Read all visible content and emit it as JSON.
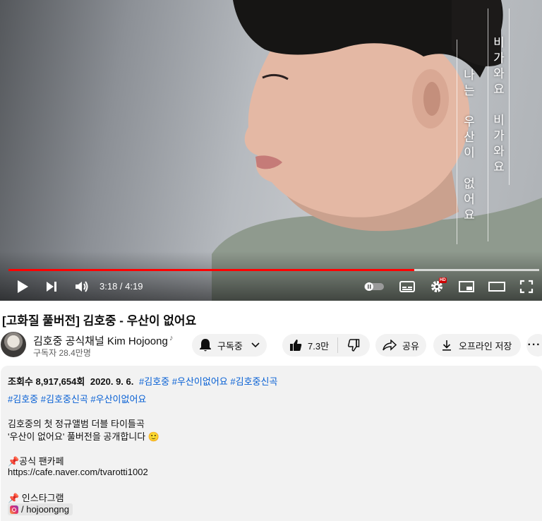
{
  "player": {
    "poem": {
      "col1": [
        "나",
        "는",
        "",
        "우",
        "산",
        "이",
        "",
        "없",
        "어",
        "요"
      ],
      "col2": [
        "비",
        "가",
        "와",
        "요",
        "",
        "비",
        "가",
        "와",
        "요"
      ]
    },
    "time_current": "3:18",
    "time_total": "4:19",
    "progress": {
      "played_fraction": 0.765,
      "buffered_fraction": 1.0
    },
    "hd_badge": "HD",
    "accent_color": "#ff0000"
  },
  "video": {
    "title": "[고화질 풀버전] 김호중 - 우산이 없어요"
  },
  "channel": {
    "name": "김호중 공식채널 Kim Hojoong",
    "verified_icon": "music-note-icon",
    "subscribers": "구독자 28.4만명"
  },
  "actions": {
    "subscribed_label": "구독중",
    "like_count": "7.3만",
    "share_label": "공유",
    "download_label": "오프라인 저장"
  },
  "description": {
    "views": "조회수 8,917,654회",
    "date": "2020. 9. 6.",
    "meta_tags": [
      "#김호중",
      "#우산이없어요",
      "#김호중신곡"
    ],
    "hashtags": [
      "#김호중",
      "#김호중신곡",
      "#우산이없어요"
    ],
    "intro_line1": "김호중의 첫 정규앨범 더블 타이틀곡",
    "intro_line2": "'우산이 없어요' 풀버전을 공개합니다 🙂",
    "cafe_label": "📌공식 팬카페",
    "cafe_url": "https://cafe.naver.com/tvarotti1002",
    "insta_label": "📌 인스타그램",
    "insta_handle": "/ hojoongng"
  }
}
